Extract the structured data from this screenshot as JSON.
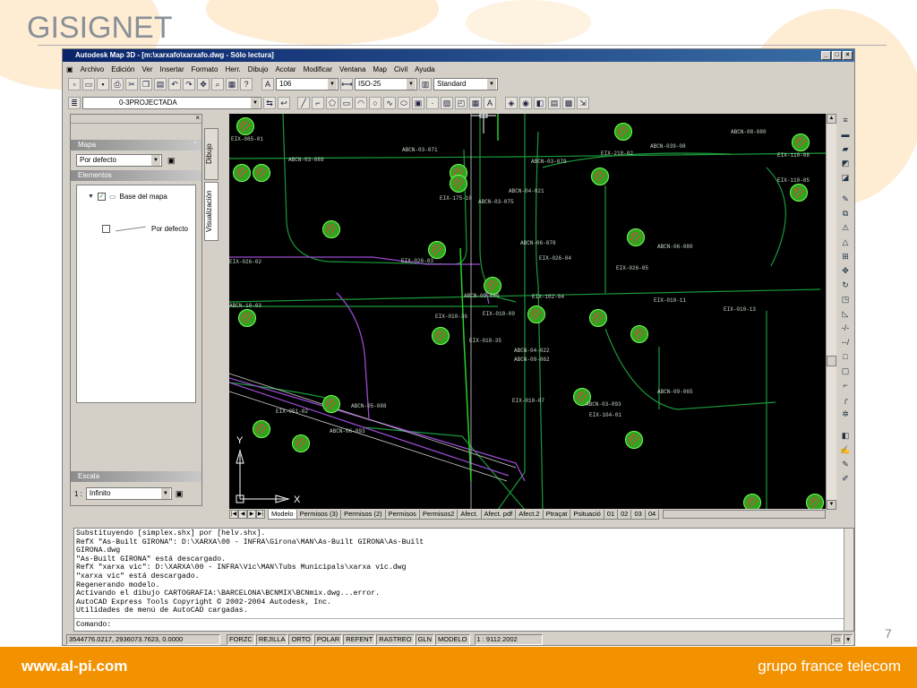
{
  "slide": {
    "title": "GISIGNET",
    "page_number": "7",
    "footer_left": "www.al-pi.com",
    "footer_right": "grupo france telecom",
    "accent_color": "#f39200"
  },
  "window": {
    "title": "Autodesk Map 3D - [m:\\xarxafo\\xarxafo.dwg - Sólo lectura]"
  },
  "menu": [
    "Archivo",
    "Edición",
    "Ver",
    "Insertar",
    "Formato",
    "Herr.",
    "Dibujo",
    "Acotar",
    "Modificar",
    "Ventana",
    "Map",
    "Civil",
    "Ayuda"
  ],
  "toolbar": {
    "text_style": "106",
    "dim_style": "ISO-25",
    "table_style": "Standard",
    "layer": "0-3PROJECTADA"
  },
  "palette": {
    "map_header": "Mapa",
    "map_select": "Por defecto",
    "elements_header": "Elementos",
    "tree_root": "Base del mapa",
    "tree_item": "Por defecto",
    "scale_header": "Escala",
    "scale_label": "1 :",
    "scale_value": "Infinito",
    "tab_dibujo": "Dibujo",
    "tab_visualizacion": "Visualización"
  },
  "drawing": {
    "labels": [
      "EIX-085-01",
      "ABCN-03-071",
      "ABCN-03-089",
      "ABCN-03-079",
      "EIX-218-02",
      "ABCN-039-08",
      "ABCN-08-080",
      "EIX-110-08",
      "EIX-175-10",
      "ABCN-04-021",
      "ABCN-03-075",
      "EIX-110-05",
      "ABCN-06-078",
      "ABCN-06-080",
      "EIX-026-03",
      "EIX-026-04",
      "EIX-026-05",
      "EIX-026-02",
      "ABCN-09-060",
      "EIX-102-04",
      "EIX-010-11",
      "EIX-010-13",
      "EIX-010-36",
      "EIX-010-09",
      "EIX-010-35",
      "ABCN-04-022",
      "ABCN-09-062",
      "EIX-010-07",
      "ABCN-09-065",
      "ABCN-03-093",
      "EIX-104-01",
      "EIX-051-02",
      "ABCN-05-088",
      "ABCN-06-093",
      "ABCN-10-03"
    ],
    "axis_y": "Y",
    "axis_x": "X"
  },
  "layout_tabs": [
    "Modelo",
    "Permisos (3)",
    "Permisos (2)",
    "Permisos",
    "Permisos2",
    "Afect.",
    "Afect. pdf",
    "Afect.2",
    "Ptraçat",
    "Psituació",
    "01",
    "02",
    "03",
    "04"
  ],
  "command_lines": [
    "Substituyendo [simplex.shx] por [helv.shx].",
    "RefX \"As-Built GIRONA\": D:\\XARXA\\00 - INFRA\\Girona\\MAN\\As-Built GIRONA\\As-Built",
    "GIRONA.dwg",
    "\"As-Built GIRONA\" está descargado.",
    "RefX \"xarxa vic\": D:\\XARXA\\00 - INFRA\\Vic\\MAN\\Tubs Municipals\\xarxa vic.dwg",
    "\"xarxa vic\" está descargado.",
    "Regenerando modelo.",
    "Activando el dibujo CARTOGRAFIA:\\BARCELONA\\BCNMIX\\BCNmix.dwg...error.",
    "AutoCAD Express Tools Copyright © 2002-2004 Autodesk, Inc.",
    "Utilidades de menú de AutoCAD cargadas."
  ],
  "command_prompt": "Comando:",
  "status": {
    "coords": "3544776.0217, 2936073.7623, 0.0000",
    "toggles": [
      "FORZC",
      "REJILLA",
      "ORTO",
      "POLAR",
      "REFENT",
      "RASTREO",
      "GLN",
      "MODELO"
    ],
    "scale": "1 : 9112.2002"
  }
}
